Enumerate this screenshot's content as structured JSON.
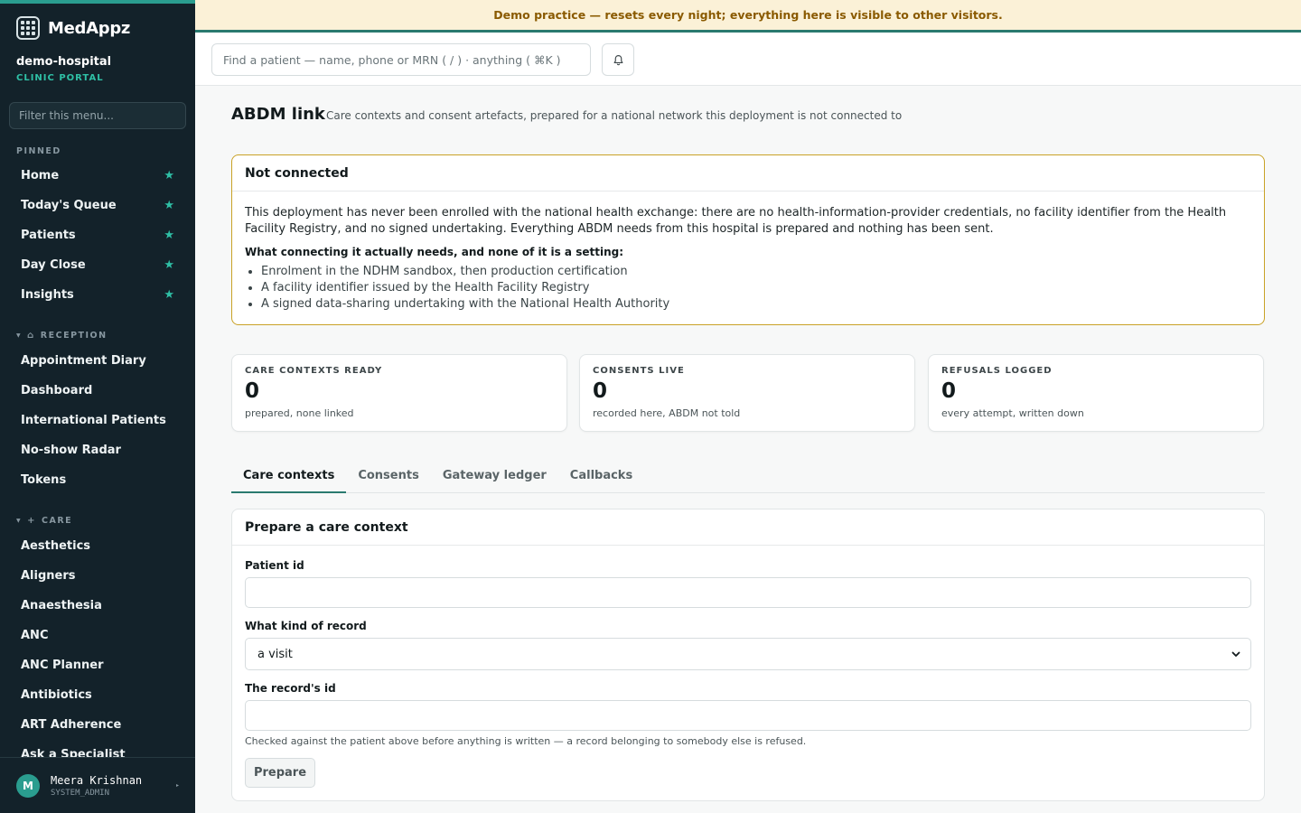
{
  "sidebar": {
    "brand": "MedAppz",
    "org_name": "demo-hospital",
    "org_sub": "CLINIC PORTAL",
    "filter_placeholder": "Filter this menu...",
    "pinned_label": "PINNED",
    "pinned": [
      {
        "label": "Home"
      },
      {
        "label": "Today's Queue"
      },
      {
        "label": "Patients"
      },
      {
        "label": "Day Close"
      },
      {
        "label": "Insights"
      }
    ],
    "reception_label": "RECEPTION",
    "reception": [
      {
        "label": "Appointment Diary"
      },
      {
        "label": "Dashboard"
      },
      {
        "label": "International Patients"
      },
      {
        "label": "No-show Radar"
      },
      {
        "label": "Tokens"
      }
    ],
    "care_label": "CARE",
    "care": [
      {
        "label": "Aesthetics"
      },
      {
        "label": "Aligners"
      },
      {
        "label": "Anaesthesia"
      },
      {
        "label": "ANC"
      },
      {
        "label": "ANC Planner"
      },
      {
        "label": "Antibiotics"
      },
      {
        "label": "ART Adherence"
      },
      {
        "label": "Ask a Specialist"
      }
    ],
    "user": {
      "initial": "M",
      "name": "Meera Krishnan",
      "role": "SYSTEM_ADMIN"
    }
  },
  "banner": "Demo practice — resets every night; everything here is visible to other visitors.",
  "topbar": {
    "search_placeholder": "Find a patient — name, phone or MRN ( / ) · anything ( ⌘K )"
  },
  "page": {
    "title": "ABDM link",
    "subtitle": "Care contexts and consent artefacts, prepared for a national network this deployment is not connected to"
  },
  "notice": {
    "title": "Not connected",
    "body": "This deployment has never been enrolled with the national health exchange: there are no health-information-provider credentials, no facility identifier from the Health Facility Registry, and no signed undertaking. Everything ABDM needs from this hospital is prepared and nothing has been sent.",
    "needs_label": "What connecting it actually needs, and none of it is a setting:",
    "needs": [
      "Enrolment in the NDHM sandbox, then production certification",
      "A facility identifier issued by the Health Facility Registry",
      "A signed data-sharing undertaking with the National Health Authority"
    ]
  },
  "stats": [
    {
      "label": "CARE CONTEXTS READY",
      "value": "0",
      "sub": "prepared, none linked"
    },
    {
      "label": "CONSENTS LIVE",
      "value": "0",
      "sub": "recorded here, ABDM not told"
    },
    {
      "label": "REFUSALS LOGGED",
      "value": "0",
      "sub": "every attempt, written down"
    }
  ],
  "tabs": [
    {
      "label": "Care contexts"
    },
    {
      "label": "Consents"
    },
    {
      "label": "Gateway ledger"
    },
    {
      "label": "Callbacks"
    }
  ],
  "form": {
    "title": "Prepare a care context",
    "patient_label": "Patient id",
    "patient_value": "",
    "kind_label": "What kind of record",
    "kind_value": "a visit",
    "record_label": "The record's id",
    "record_value": "",
    "hint": "Checked against the patient above before anything is written — a record belonging to somebody else is refused.",
    "submit_label": "Prepare"
  },
  "colors": {
    "sidebar_bg": "#13222a",
    "accent": "#2a9d8f",
    "banner_bg": "#fbf1d7",
    "banner_text": "#8a5a00",
    "notice_border": "#c9a227"
  }
}
